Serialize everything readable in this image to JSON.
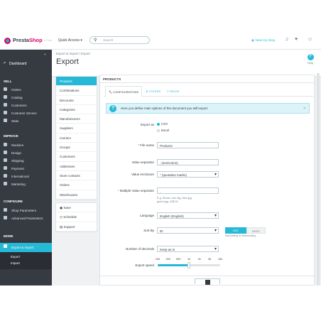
{
  "topbar": {
    "brand_pre": "Presta",
    "brand_post": "Shop",
    "version": "1.7.4.4",
    "quick_access": "Quick Access ▾",
    "search_placeholder": "Search",
    "view_shop": "View my shop"
  },
  "sidebar": {
    "dashboard": "Dashboard",
    "sections": [
      {
        "title": "SELL",
        "items": [
          "Orders",
          "Catalog",
          "Customers",
          "Customer Service",
          "Stats"
        ]
      },
      {
        "title": "IMPROVE",
        "items": [
          "Modules",
          "Design",
          "Shipping",
          "Payment",
          "International",
          "Marketing"
        ]
      },
      {
        "title": "CONFIGURE",
        "items": [
          "Shop Parameters",
          "Advanced Parameters"
        ]
      },
      {
        "title": "MORE",
        "items": [
          "Export & Import"
        ]
      }
    ],
    "subitems": [
      "Export",
      "Import"
    ]
  },
  "header": {
    "breadcrumb": "Export & Import  /  Export",
    "title": "Export",
    "help": "Help"
  },
  "menu": {
    "items": [
      "Products",
      "Combinations",
      "Discounts",
      "Categories",
      "Manufacturers",
      "Suppliers",
      "Carriers",
      "Groups",
      "Customers",
      "Addresses",
      "Store contacts",
      "Orders",
      "Warehouses"
    ],
    "actions": [
      "Save",
      "Schedule",
      "Support"
    ]
  },
  "panel": {
    "title": "PRODUCTS",
    "tabs": [
      "CONFIGURATIONS",
      "FILTERS",
      "FIELDS"
    ],
    "alert": "Here you define main options of the document you will export.",
    "fields": {
      "export_as_label": "Export as",
      "export_as_options": [
        "CSV",
        "Excel"
      ],
      "file_name_label": "File name",
      "file_name_value": "Products",
      "value_separator_label": "Value separator",
      "value_separator_value": "; (semicolon)",
      "value_enclosure_label": "Value enclosure",
      "value_enclosure_value": "\" (quotation marks)",
      "multiple_separator_label": "Multiple Value separator",
      "multiple_separator_value": ",",
      "multiple_separator_hint": "E.g. Shoes, red, big, blue.jpg, green.jpg, 12$.00",
      "language_label": "Language",
      "language_value": "English (English)",
      "sort_by_label": "Sort By",
      "sort_by_value": "ID",
      "sort_asc": "ASC",
      "sort_desc": "DESC",
      "sort_hint": "Ascending or descending",
      "decimals_label": "Number of decimals",
      "decimals_value": "Keep as is",
      "speed_label": "Export speed",
      "speed_ticks": [
        "100",
        "200",
        "500",
        "1k",
        "2k",
        "5k",
        "10k"
      ],
      "speed_level": 0.5
    }
  },
  "colors": {
    "accent": "#25b9d7",
    "sidebar": "#363a41",
    "brand_pink": "#df0067"
  }
}
